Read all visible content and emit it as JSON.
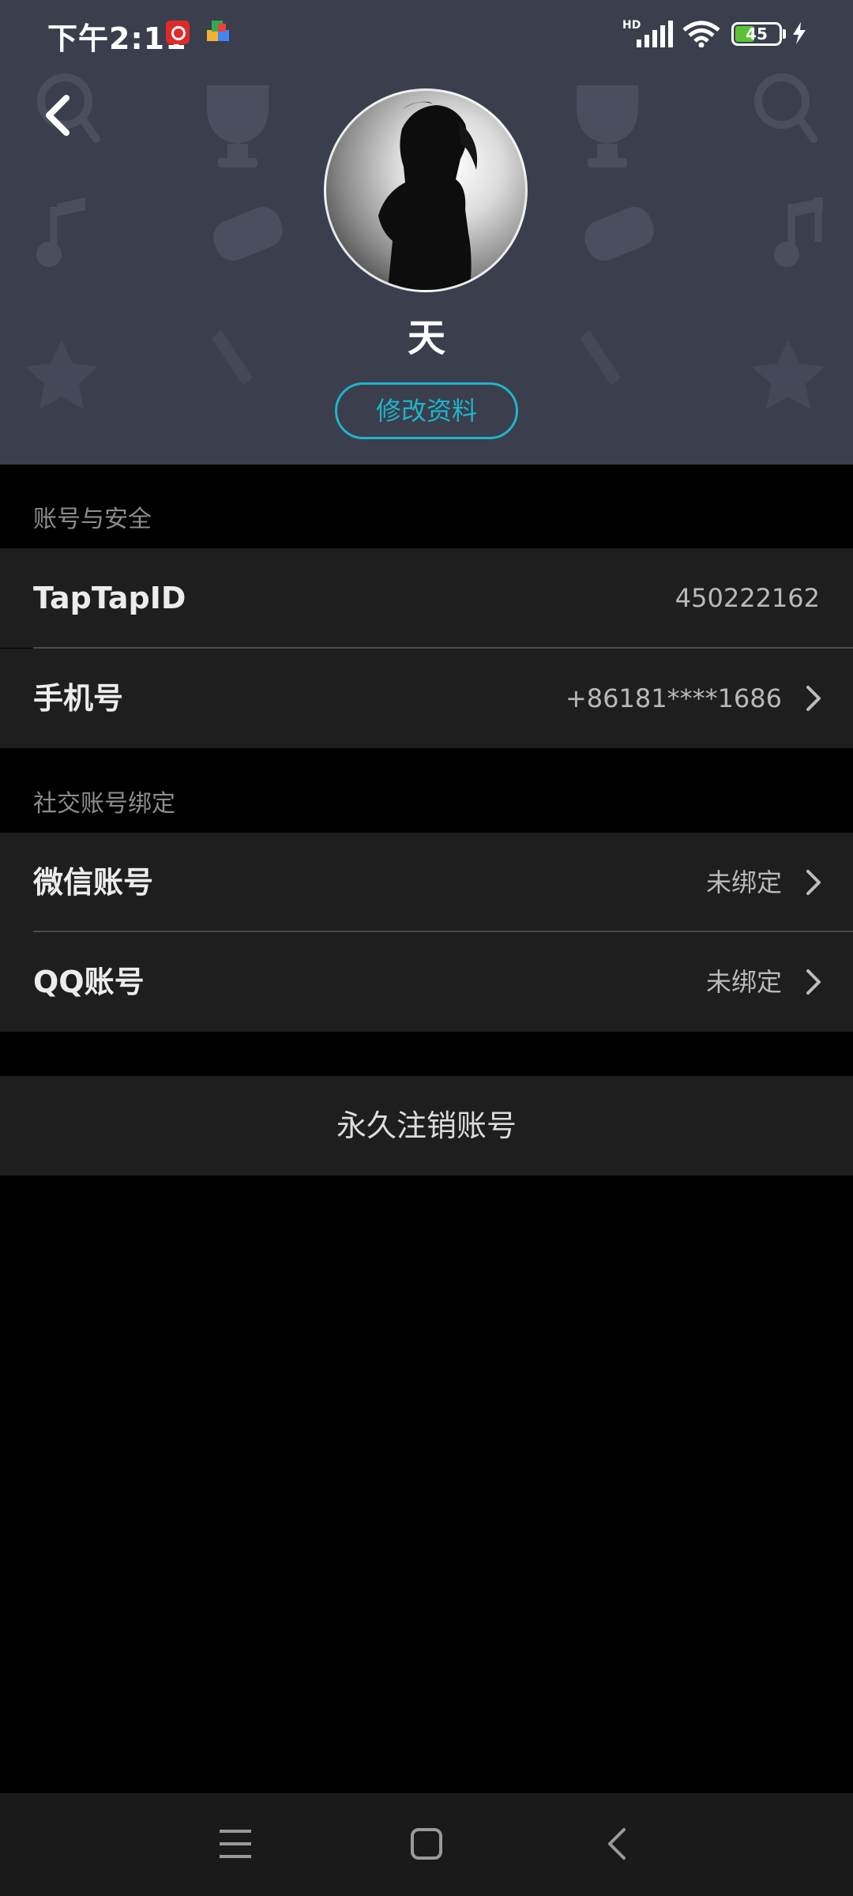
{
  "status_bar": {
    "time": "下午2:11",
    "network": "HD",
    "battery": "45",
    "battery_level": 0.45,
    "icons": [
      "netease-music-icon",
      "puzzle-app-icon",
      "signal-icon",
      "wifi-icon",
      "battery-icon",
      "charging-icon"
    ]
  },
  "profile": {
    "username": "天",
    "edit_label": "修改资料"
  },
  "account_security": {
    "label": "账号与安全",
    "taptap_id": {
      "title": "TapTapID",
      "value": "450222162"
    },
    "phone": {
      "title": "手机号",
      "value": "+86181****1686"
    }
  },
  "social_binding": {
    "label": "社交账号绑定",
    "wechat": {
      "title": "微信账号",
      "value": "未绑定"
    },
    "qq": {
      "title": "QQ账号",
      "value": "未绑定"
    }
  },
  "delete_account_label": "永久注销账号",
  "colors": {
    "header_bg": "#3a3e4d",
    "accent": "#1fb4c9",
    "row_bg": "#1e1e1e",
    "page_bg": "#000000"
  },
  "nav": {
    "icons": [
      "menu-icon",
      "home-icon",
      "back-icon"
    ]
  }
}
